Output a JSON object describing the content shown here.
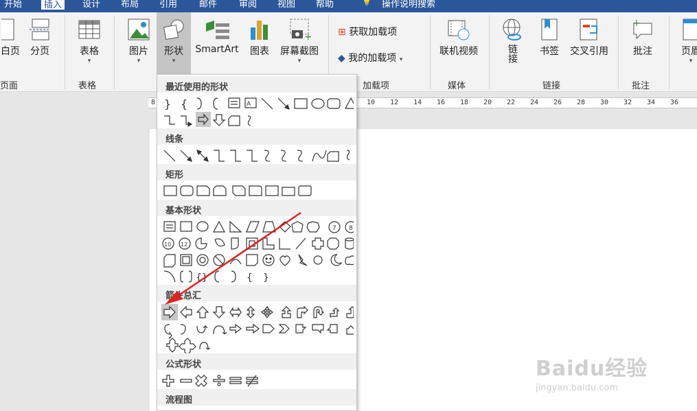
{
  "tabs": [
    "开始",
    "插入",
    "设计",
    "布局",
    "引用",
    "邮件",
    "审阅",
    "视图",
    "帮助",
    "操作说明搜索"
  ],
  "ribbon": {
    "blank_page": "白页",
    "page_break": "分页",
    "group_pages": "页面",
    "table": "表格",
    "group_table": "表格",
    "picture": "图片",
    "shapes": "形状",
    "smartart": "SmartArt",
    "chart": "图表",
    "screenshot": "屏幕截图",
    "get_addins": "获取加载项",
    "my_addins": "我的加载项",
    "group_addins": "加载项",
    "online_video": "联机视频",
    "group_media": "媒体",
    "link": "链接",
    "bookmark": "书签",
    "crossref": "交叉引用",
    "group_links": "链接",
    "comment": "批注",
    "group_comments": "批注",
    "header": "页眉"
  },
  "ruler": [
    "8",
    "10",
    "12",
    "14",
    "16",
    "18",
    "20",
    "22",
    "24",
    "26",
    "28",
    "30",
    "32",
    "34",
    "36"
  ],
  "menu": {
    "recent": "最近使用的形状",
    "lines": "线条",
    "rect": "矩形",
    "basic": "基本形状",
    "arrows": "箭头总汇",
    "equation": "公式形状",
    "flowchart": "流程图"
  },
  "icons": {
    "accent": "#2b579a",
    "annotation_arrow": "#e02020"
  },
  "watermark": {
    "brand": "Baidu经验",
    "url": "jingyan.baidu.com"
  }
}
